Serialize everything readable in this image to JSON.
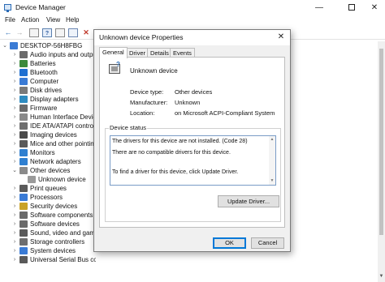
{
  "window": {
    "title": "Device Manager",
    "controls": {
      "minimize": "—",
      "maximize": "",
      "close": "✕"
    }
  },
  "menu": [
    "File",
    "Action",
    "View",
    "Help"
  ],
  "toolbar": {
    "back": "←",
    "forward": "→",
    "properties": "▤",
    "help": "?",
    "update": "▦",
    "scan": "▣",
    "remove": "✕"
  },
  "tree": {
    "root": "DESKTOP-56H8FBG",
    "items": [
      {
        "label": "Audio inputs and outputs",
        "chevron": "›",
        "color": "#6b6b6b"
      },
      {
        "label": "Batteries",
        "chevron": "›",
        "color": "#3c8a3c"
      },
      {
        "label": "Bluetooth",
        "chevron": "›",
        "color": "#1f6fd1"
      },
      {
        "label": "Computer",
        "chevron": "›",
        "color": "#3a7bd5"
      },
      {
        "label": "Disk drives",
        "chevron": "›",
        "color": "#7a7a7a"
      },
      {
        "label": "Display adapters",
        "chevron": "›",
        "color": "#2e8bc0"
      },
      {
        "label": "Firmware",
        "chevron": "›",
        "color": "#6a6a6a"
      },
      {
        "label": "Human Interface Devices",
        "chevron": "›",
        "color": "#8a8a8a"
      },
      {
        "label": "IDE ATA/ATAPI controllers",
        "chevron": "›",
        "color": "#6e6e6e"
      },
      {
        "label": "Imaging devices",
        "chevron": "›",
        "color": "#4a4a4a"
      },
      {
        "label": "Mice and other pointing",
        "chevron": "›",
        "color": "#5a5a5a"
      },
      {
        "label": "Monitors",
        "chevron": "›",
        "color": "#2f7fd0"
      },
      {
        "label": "Network adapters",
        "chevron": "›",
        "color": "#2f7fd0"
      },
      {
        "label": "Other devices",
        "chevron": "⌄",
        "color": "#8a8a8a"
      },
      {
        "label": "Unknown device",
        "chevron": "",
        "color": "#9a9a9a",
        "indent": true
      },
      {
        "label": "Print queues",
        "chevron": "›",
        "color": "#5a5a5a"
      },
      {
        "label": "Processors",
        "chevron": "›",
        "color": "#3a7bd5"
      },
      {
        "label": "Security devices",
        "chevron": "›",
        "color": "#c9a227"
      },
      {
        "label": "Software components",
        "chevron": "›",
        "color": "#6a6a6a"
      },
      {
        "label": "Software devices",
        "chevron": "›",
        "color": "#6a6a6a"
      },
      {
        "label": "Sound, video and game",
        "chevron": "›",
        "color": "#5a5a5a"
      },
      {
        "label": "Storage controllers",
        "chevron": "›",
        "color": "#6e6e6e"
      },
      {
        "label": "System devices",
        "chevron": "›",
        "color": "#3a7bd5"
      },
      {
        "label": "Universal Serial Bus controllers",
        "chevron": "›",
        "color": "#5a5a5a"
      }
    ]
  },
  "dialog": {
    "title": "Unknown device Properties",
    "close": "✕",
    "tabs": [
      "General",
      "Driver",
      "Details",
      "Events"
    ],
    "device_name": "Unknown device",
    "properties": {
      "type_label": "Device type:",
      "type_value": "Other devices",
      "manufacturer_label": "Manufacturer:",
      "manufacturer_value": "Unknown",
      "location_label": "Location:",
      "location_value": "on Microsoft ACPI-Compliant System"
    },
    "status": {
      "legend": "Device status",
      "line1": "The drivers for this device are not installed. (Code 28)",
      "line2": "There are no compatible drivers for this device.",
      "line3": "To find a driver for this device, click Update Driver."
    },
    "update_button": "Update Driver...",
    "ok_button": "OK",
    "cancel_button": "Cancel"
  }
}
